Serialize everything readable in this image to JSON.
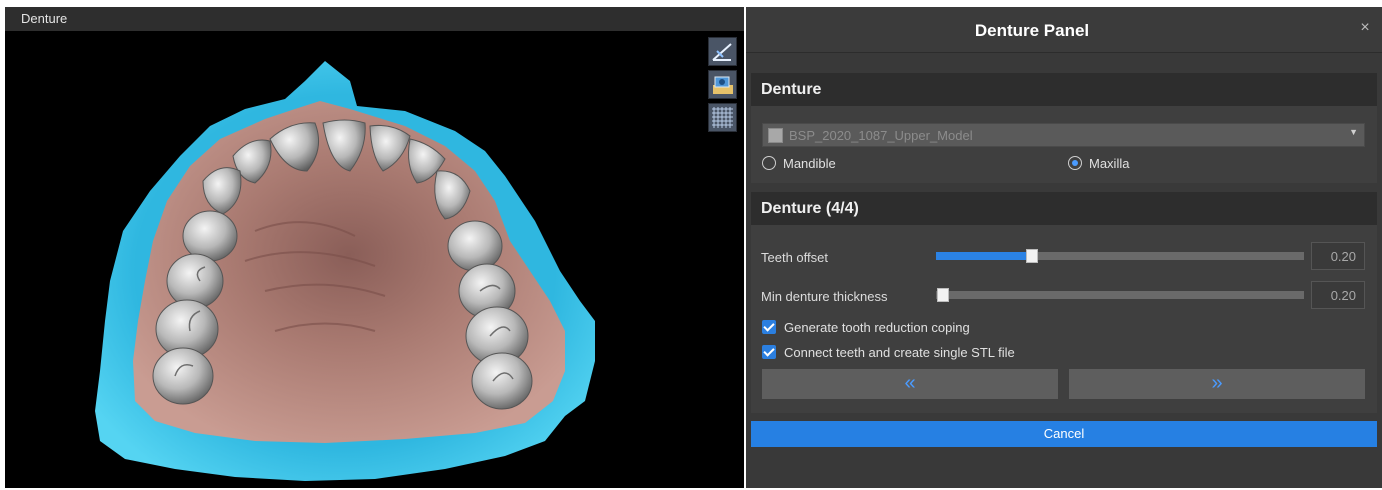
{
  "viewport": {
    "title": "Denture",
    "tools": [
      {
        "name": "clip-plane-icon"
      },
      {
        "name": "screenshot-icon"
      },
      {
        "name": "grid-icon"
      }
    ]
  },
  "panel": {
    "title": "Denture Panel",
    "close_glyph": "×",
    "section1": {
      "title": "Denture",
      "model_select": "BSP_2020_1087_Upper_Model",
      "radio_mandible": "Mandible",
      "radio_maxilla": "Maxilla",
      "selected": "Maxilla"
    },
    "section2": {
      "title": "Denture (4/4)",
      "teeth_offset_label": "Teeth offset",
      "teeth_offset_value": "0.20",
      "teeth_offset_fraction": 0.26,
      "min_thickness_label": "Min denture thickness",
      "min_thickness_value": "0.20",
      "min_thickness_fraction": 0.02,
      "checkbox1": "Generate tooth reduction coping",
      "checkbox2": "Connect teeth and create single STL file",
      "prev_glyph": "«",
      "next_glyph": "»"
    },
    "cancel_label": "Cancel"
  },
  "colors": {
    "accent": "#2680e3",
    "gum": "#b98a80",
    "scan": "#3cc4e8",
    "tooth": "#b5b5b5"
  }
}
